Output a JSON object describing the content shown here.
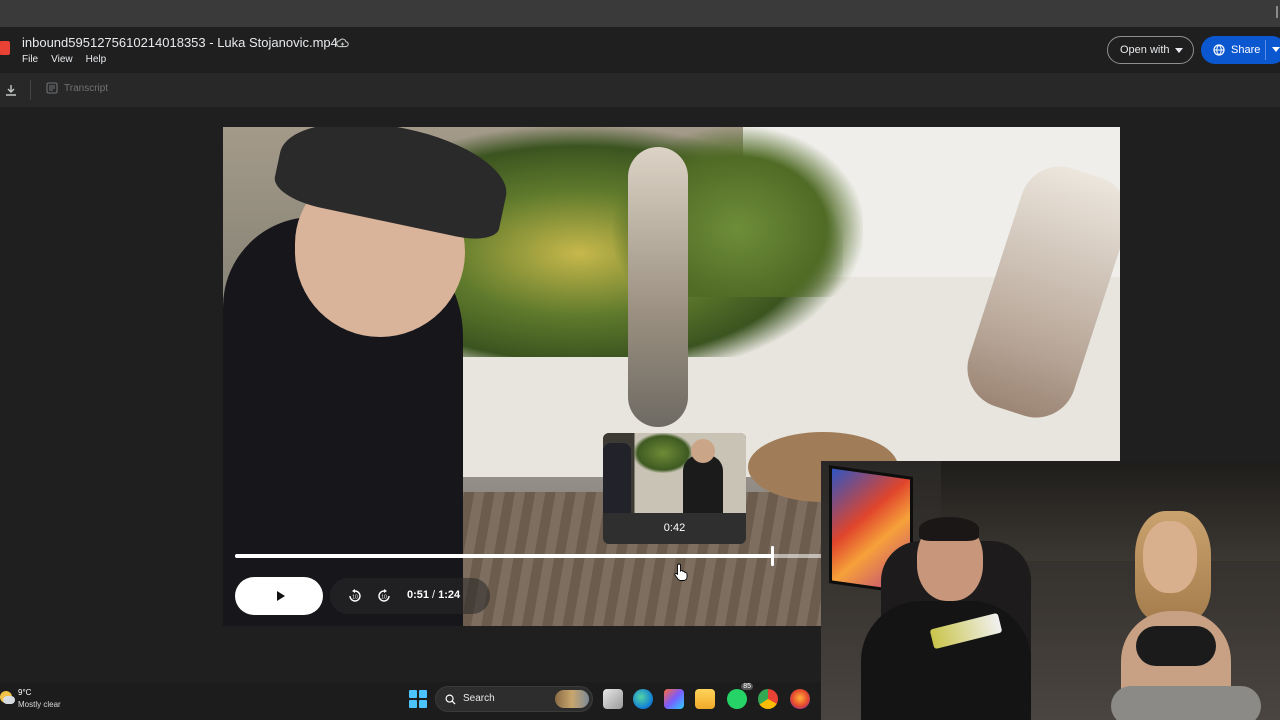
{
  "header": {
    "title": "inbound5951275610214018353 - Luka Stojanovic.mp4",
    "menus": [
      "File",
      "View",
      "Help"
    ],
    "open_with_label": "Open with",
    "share_label": "Share"
  },
  "toolbar": {
    "transcript_label": "Transcript"
  },
  "player": {
    "current_time": "0:51",
    "separator": "/",
    "duration": "1:24",
    "preview_time": "0:42",
    "progress_fraction": 0.607
  },
  "taskbar": {
    "weather_temp": "9°C",
    "weather_condition": "Mostly clear",
    "search_label": "Search",
    "whatsapp_badge": "85"
  },
  "colors": {
    "accent": "#0b57d0",
    "background": "#1f1f1f"
  }
}
